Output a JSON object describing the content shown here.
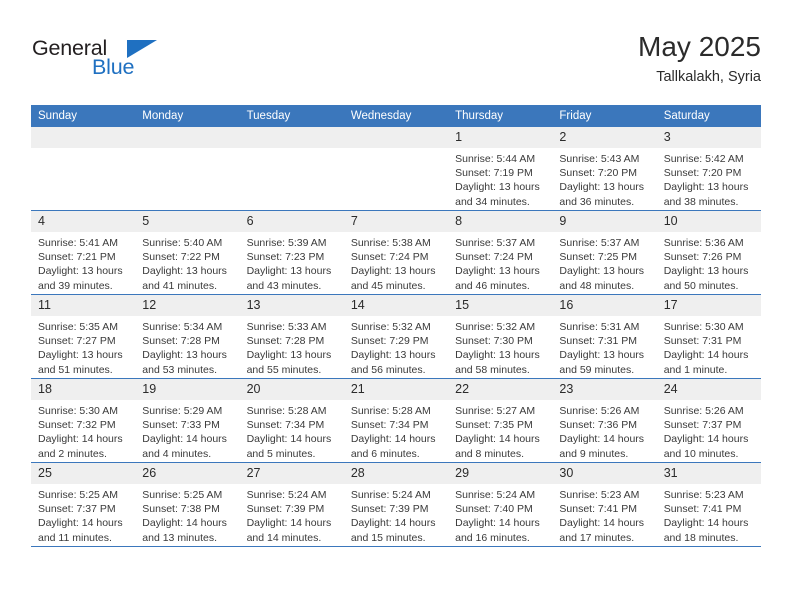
{
  "brand": {
    "logo_text_top": "General",
    "logo_text_bottom": "Blue",
    "accent_color": "#1f70c1",
    "triangle_icon": "triangle-icon"
  },
  "header": {
    "title": "May 2025",
    "subtitle": "Tallkalakh, Syria"
  },
  "calendar": {
    "header_bg": "#3b77bc",
    "daynum_bg": "#efefef",
    "weekdays": [
      "Sunday",
      "Monday",
      "Tuesday",
      "Wednesday",
      "Thursday",
      "Friday",
      "Saturday"
    ],
    "weeks": [
      [
        {
          "day": "",
          "sunrise": "",
          "sunset": "",
          "daylight": "",
          "empty": true
        },
        {
          "day": "",
          "sunrise": "",
          "sunset": "",
          "daylight": "",
          "empty": true
        },
        {
          "day": "",
          "sunrise": "",
          "sunset": "",
          "daylight": "",
          "empty": true
        },
        {
          "day": "",
          "sunrise": "",
          "sunset": "",
          "daylight": "",
          "empty": true
        },
        {
          "day": "1",
          "sunrise": "Sunrise: 5:44 AM",
          "sunset": "Sunset: 7:19 PM",
          "daylight": "Daylight: 13 hours and 34 minutes."
        },
        {
          "day": "2",
          "sunrise": "Sunrise: 5:43 AM",
          "sunset": "Sunset: 7:20 PM",
          "daylight": "Daylight: 13 hours and 36 minutes."
        },
        {
          "day": "3",
          "sunrise": "Sunrise: 5:42 AM",
          "sunset": "Sunset: 7:20 PM",
          "daylight": "Daylight: 13 hours and 38 minutes."
        }
      ],
      [
        {
          "day": "4",
          "sunrise": "Sunrise: 5:41 AM",
          "sunset": "Sunset: 7:21 PM",
          "daylight": "Daylight: 13 hours and 39 minutes."
        },
        {
          "day": "5",
          "sunrise": "Sunrise: 5:40 AM",
          "sunset": "Sunset: 7:22 PM",
          "daylight": "Daylight: 13 hours and 41 minutes."
        },
        {
          "day": "6",
          "sunrise": "Sunrise: 5:39 AM",
          "sunset": "Sunset: 7:23 PM",
          "daylight": "Daylight: 13 hours and 43 minutes."
        },
        {
          "day": "7",
          "sunrise": "Sunrise: 5:38 AM",
          "sunset": "Sunset: 7:24 PM",
          "daylight": "Daylight: 13 hours and 45 minutes."
        },
        {
          "day": "8",
          "sunrise": "Sunrise: 5:37 AM",
          "sunset": "Sunset: 7:24 PM",
          "daylight": "Daylight: 13 hours and 46 minutes."
        },
        {
          "day": "9",
          "sunrise": "Sunrise: 5:37 AM",
          "sunset": "Sunset: 7:25 PM",
          "daylight": "Daylight: 13 hours and 48 minutes."
        },
        {
          "day": "10",
          "sunrise": "Sunrise: 5:36 AM",
          "sunset": "Sunset: 7:26 PM",
          "daylight": "Daylight: 13 hours and 50 minutes."
        }
      ],
      [
        {
          "day": "11",
          "sunrise": "Sunrise: 5:35 AM",
          "sunset": "Sunset: 7:27 PM",
          "daylight": "Daylight: 13 hours and 51 minutes."
        },
        {
          "day": "12",
          "sunrise": "Sunrise: 5:34 AM",
          "sunset": "Sunset: 7:28 PM",
          "daylight": "Daylight: 13 hours and 53 minutes."
        },
        {
          "day": "13",
          "sunrise": "Sunrise: 5:33 AM",
          "sunset": "Sunset: 7:28 PM",
          "daylight": "Daylight: 13 hours and 55 minutes."
        },
        {
          "day": "14",
          "sunrise": "Sunrise: 5:32 AM",
          "sunset": "Sunset: 7:29 PM",
          "daylight": "Daylight: 13 hours and 56 minutes."
        },
        {
          "day": "15",
          "sunrise": "Sunrise: 5:32 AM",
          "sunset": "Sunset: 7:30 PM",
          "daylight": "Daylight: 13 hours and 58 minutes."
        },
        {
          "day": "16",
          "sunrise": "Sunrise: 5:31 AM",
          "sunset": "Sunset: 7:31 PM",
          "daylight": "Daylight: 13 hours and 59 minutes."
        },
        {
          "day": "17",
          "sunrise": "Sunrise: 5:30 AM",
          "sunset": "Sunset: 7:31 PM",
          "daylight": "Daylight: 14 hours and 1 minute."
        }
      ],
      [
        {
          "day": "18",
          "sunrise": "Sunrise: 5:30 AM",
          "sunset": "Sunset: 7:32 PM",
          "daylight": "Daylight: 14 hours and 2 minutes."
        },
        {
          "day": "19",
          "sunrise": "Sunrise: 5:29 AM",
          "sunset": "Sunset: 7:33 PM",
          "daylight": "Daylight: 14 hours and 4 minutes."
        },
        {
          "day": "20",
          "sunrise": "Sunrise: 5:28 AM",
          "sunset": "Sunset: 7:34 PM",
          "daylight": "Daylight: 14 hours and 5 minutes."
        },
        {
          "day": "21",
          "sunrise": "Sunrise: 5:28 AM",
          "sunset": "Sunset: 7:34 PM",
          "daylight": "Daylight: 14 hours and 6 minutes."
        },
        {
          "day": "22",
          "sunrise": "Sunrise: 5:27 AM",
          "sunset": "Sunset: 7:35 PM",
          "daylight": "Daylight: 14 hours and 8 minutes."
        },
        {
          "day": "23",
          "sunrise": "Sunrise: 5:26 AM",
          "sunset": "Sunset: 7:36 PM",
          "daylight": "Daylight: 14 hours and 9 minutes."
        },
        {
          "day": "24",
          "sunrise": "Sunrise: 5:26 AM",
          "sunset": "Sunset: 7:37 PM",
          "daylight": "Daylight: 14 hours and 10 minutes."
        }
      ],
      [
        {
          "day": "25",
          "sunrise": "Sunrise: 5:25 AM",
          "sunset": "Sunset: 7:37 PM",
          "daylight": "Daylight: 14 hours and 11 minutes."
        },
        {
          "day": "26",
          "sunrise": "Sunrise: 5:25 AM",
          "sunset": "Sunset: 7:38 PM",
          "daylight": "Daylight: 14 hours and 13 minutes."
        },
        {
          "day": "27",
          "sunrise": "Sunrise: 5:24 AM",
          "sunset": "Sunset: 7:39 PM",
          "daylight": "Daylight: 14 hours and 14 minutes."
        },
        {
          "day": "28",
          "sunrise": "Sunrise: 5:24 AM",
          "sunset": "Sunset: 7:39 PM",
          "daylight": "Daylight: 14 hours and 15 minutes."
        },
        {
          "day": "29",
          "sunrise": "Sunrise: 5:24 AM",
          "sunset": "Sunset: 7:40 PM",
          "daylight": "Daylight: 14 hours and 16 minutes."
        },
        {
          "day": "30",
          "sunrise": "Sunrise: 5:23 AM",
          "sunset": "Sunset: 7:41 PM",
          "daylight": "Daylight: 14 hours and 17 minutes."
        },
        {
          "day": "31",
          "sunrise": "Sunrise: 5:23 AM",
          "sunset": "Sunset: 7:41 PM",
          "daylight": "Daylight: 14 hours and 18 minutes."
        }
      ]
    ]
  }
}
